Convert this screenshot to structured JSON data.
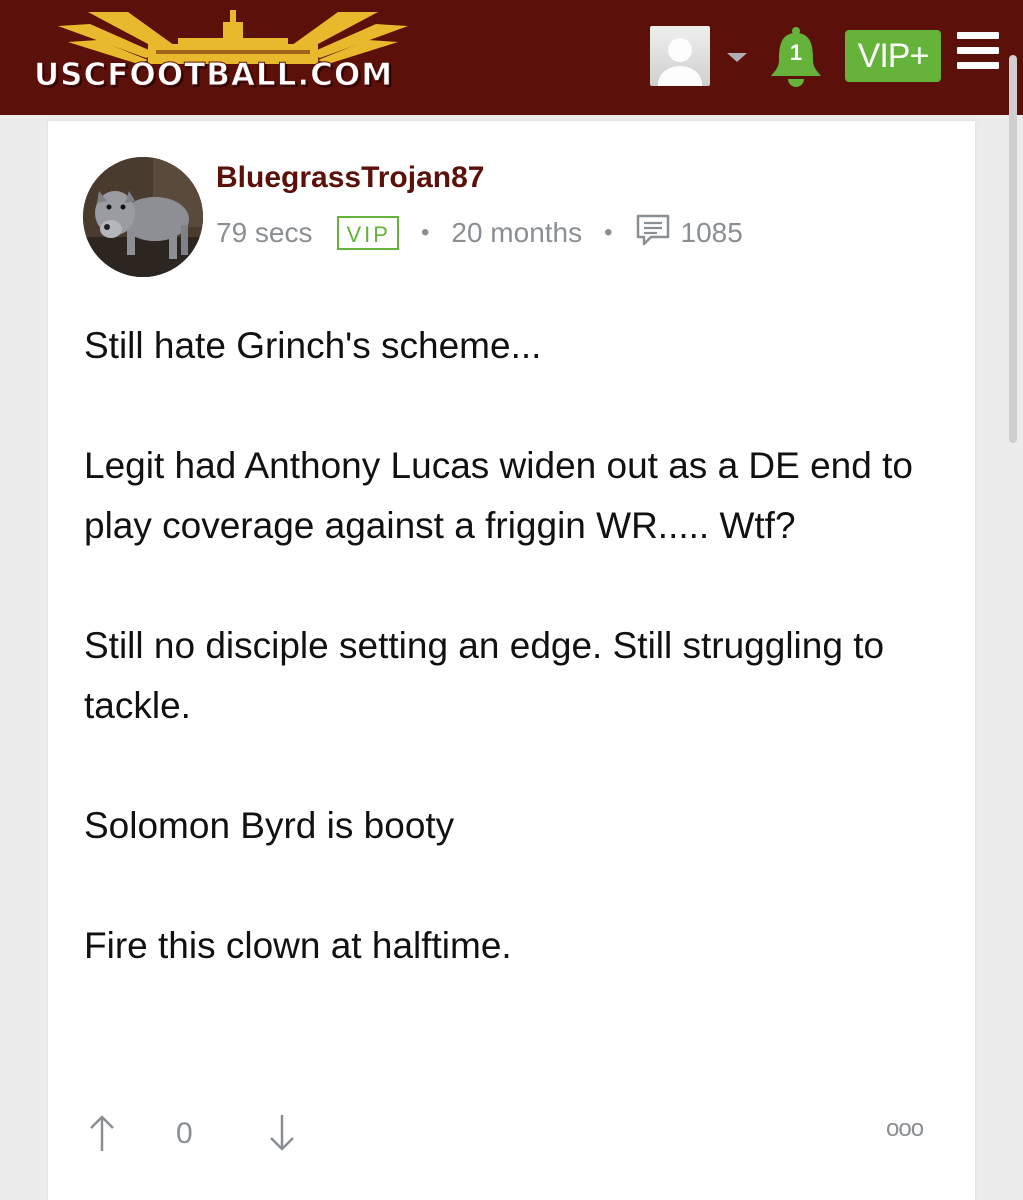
{
  "site": {
    "logo_text": "USCFOOTBALL.COM",
    "notification_count": "1",
    "vip_button": "VIP+"
  },
  "post": {
    "username": "BluegrassTrojan87",
    "time_ago": "79 secs",
    "badge": "VIP",
    "member_duration": "20 months",
    "post_count": "1085",
    "paragraphs": [
      "Still hate Grinch's scheme...",
      "Legit had Anthony Lucas widen out as a DE end to play coverage against a friggin WR..... Wtf?",
      "Still no disciple setting an edge. Still struggling to tackle.",
      "Solomon Byrd is booty",
      "Fire this clown at halftime."
    ],
    "score": "0",
    "more_label": "ooo"
  },
  "colors": {
    "header_bg": "#5c100a",
    "username": "#5c100a",
    "vip_green": "#65b33a",
    "meta_gray": "#8a8f94"
  },
  "icons": [
    "user-avatar-placeholder",
    "caret-down-icon",
    "bell-icon",
    "hamburger-menu-icon",
    "comment-icon",
    "upvote-arrow-icon",
    "downvote-arrow-icon",
    "more-options-icon"
  ]
}
